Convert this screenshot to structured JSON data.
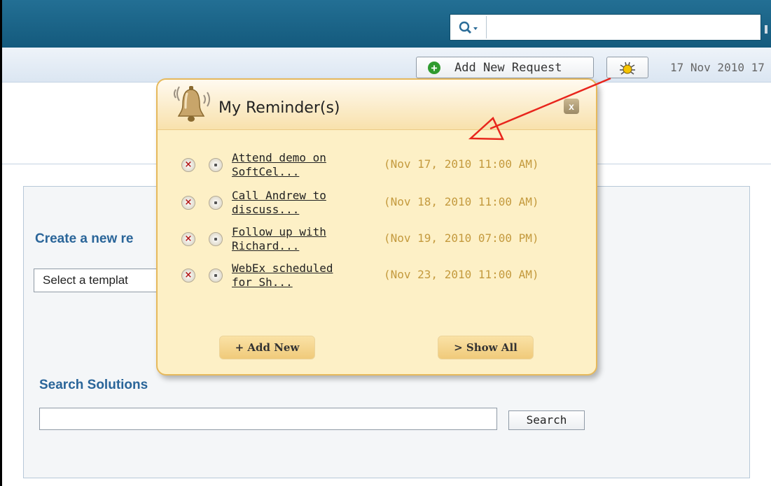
{
  "toolbar": {
    "add_request_label": "Add New Request",
    "date_text": "17 Nov 2010 17"
  },
  "search": {
    "value": ""
  },
  "main": {
    "create_heading": "Create a new re",
    "template_select": "Select a templat",
    "search_heading": "Search Solutions",
    "search_button": "Search"
  },
  "popup": {
    "title": "My Reminder(s)",
    "close_label": "x",
    "items": [
      {
        "text": "Attend demo on\nSoftCel...",
        "time": "(Nov 17, 2010 11:00 AM)"
      },
      {
        "text": "Call Andrew to\ndiscuss...",
        "time": "(Nov 18, 2010 11:00 AM)"
      },
      {
        "text": "Follow up with\nRichard...",
        "time": "(Nov 19, 2010 07:00 PM)"
      },
      {
        "text": "WebEx scheduled\nfor Sh...",
        "time": "(Nov 23, 2010 11:00 AM)"
      }
    ],
    "delete_glyph": "×",
    "add_new_label": "+ Add New",
    "show_all_label": "> Show All"
  },
  "colors": {
    "header_bar": "#145a7d",
    "heading_blue": "#2a6599",
    "popup_bg": "#fdf0c6",
    "reminder_time": "#c49a3e",
    "annotation_arrow": "#e8251c"
  }
}
